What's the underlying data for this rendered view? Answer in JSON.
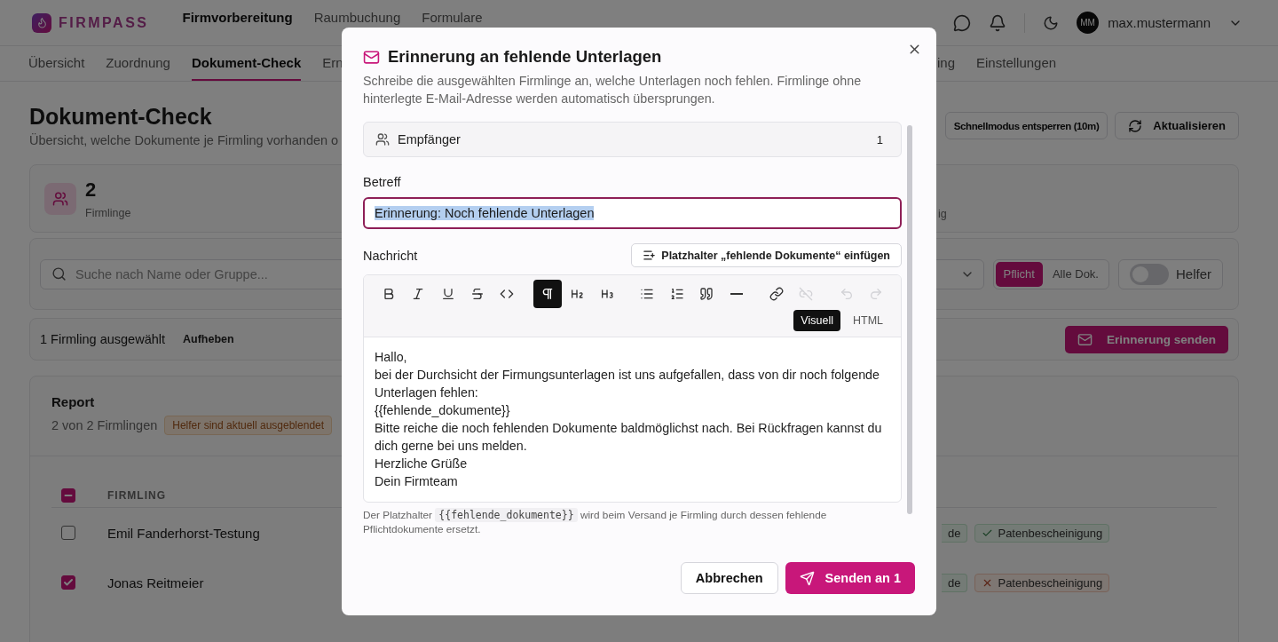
{
  "header": {
    "logo": "FIRMPASS",
    "nav": [
      {
        "label": "Firmvorbereitung",
        "selected": true
      },
      {
        "label": "Raumbuchung",
        "selected": false
      },
      {
        "label": "Formulare",
        "selected": false
      }
    ],
    "user": {
      "initials": "MM",
      "name": "max.mustermann"
    }
  },
  "subnav": {
    "tabs_left": [
      {
        "label": "Übersicht",
        "selected": false
      },
      {
        "label": "Zuordnung",
        "selected": false
      },
      {
        "label": "Dokument-Check",
        "selected": true
      },
      {
        "label": "Ern",
        "selected": false
      }
    ],
    "tabs_right": [
      {
        "label": "ing",
        "selected": false
      },
      {
        "label": "Einstellungen",
        "selected": false
      }
    ]
  },
  "page": {
    "title": "Dokument-Check",
    "subtitle": "Übersicht, welche Dokumente je Firmling vorhanden o",
    "unlock_button": "Schnellmodus entsperren (10m)",
    "refresh_button": "Aktualisieren"
  },
  "stats": {
    "value": "2",
    "label": "Firmlinge",
    "label_2": "ig"
  },
  "filters": {
    "search_placeholder": "Suche nach Name oder Gruppe...",
    "segments": [
      {
        "label": "Pflicht",
        "selected": true
      },
      {
        "label": "Alle Dok.",
        "selected": false
      }
    ],
    "helper_toggle": {
      "label": "Helfer",
      "on": false
    }
  },
  "selection": {
    "text": "1 Firmling ausgewählt",
    "clear": "Aufheben",
    "send": "Erinnerung senden"
  },
  "report": {
    "title": "Report",
    "subtitle": "2 von 2 Firmlingen",
    "badge": "Helfer sind aktuell ausgeblendet",
    "column": "FIRMLING",
    "header_checkbox": {
      "indeterminate": true
    },
    "rows": [
      {
        "name": "Emil Fanderhorst-Testung",
        "checked": false,
        "tags": [
          {
            "label": "de",
            "missing": false,
            "cut": true
          },
          {
            "label": "Patenbescheinigung",
            "missing": false,
            "cut": false
          }
        ]
      },
      {
        "name": "Jonas Reitmeier",
        "checked": true,
        "tags": [
          {
            "label": "de",
            "missing": false,
            "cut": true
          },
          {
            "label": "Patenbescheinigung",
            "missing": true,
            "cut": false
          }
        ]
      }
    ]
  },
  "dialog": {
    "title": "Erinnerung an fehlende Unterlagen",
    "description": "Schreibe die ausgewählten Firmlinge an, welche Unterlagen noch fehlen. Firmlinge ohne hinterlegte E-Mail-Adresse werden automatisch übersprungen.",
    "recipients": {
      "label": "Empfänger",
      "count": "1"
    },
    "subject": {
      "label": "Betreff",
      "value": "Erinnerung: Noch fehlende Unterlagen",
      "text_selected": true
    },
    "message": {
      "label": "Nachricht",
      "insert_button": "Platzhalter „fehlende Dokumente“ einfügen",
      "toolbar": [
        {
          "kind": "bold",
          "active": false,
          "disabled": false
        },
        {
          "kind": "italic",
          "active": false,
          "disabled": false
        },
        {
          "kind": "underline",
          "active": false,
          "disabled": false
        },
        {
          "kind": "strike",
          "active": false,
          "disabled": false
        },
        {
          "kind": "code",
          "active": false,
          "disabled": false
        },
        {
          "kind": "paragraph",
          "active": true,
          "disabled": false
        },
        {
          "kind": "h2",
          "active": false,
          "disabled": false
        },
        {
          "kind": "h3",
          "active": false,
          "disabled": false
        },
        {
          "kind": "bullets",
          "active": false,
          "disabled": false
        },
        {
          "kind": "numbers",
          "active": false,
          "disabled": false
        },
        {
          "kind": "quote",
          "active": false,
          "disabled": false
        },
        {
          "kind": "rule",
          "active": false,
          "disabled": false
        },
        {
          "kind": "link",
          "active": false,
          "disabled": false
        },
        {
          "kind": "unlink",
          "active": false,
          "disabled": true
        },
        {
          "kind": "undo",
          "active": false,
          "disabled": true
        },
        {
          "kind": "redo",
          "active": false,
          "disabled": true
        }
      ],
      "modes": [
        {
          "label": "Visuell",
          "selected": true
        },
        {
          "label": "HTML",
          "selected": false
        }
      ],
      "lines": [
        "Hallo,",
        "bei der Durchsicht der Firmungsunterlagen ist uns aufgefallen, dass von dir noch folgende Unterlagen fehlen:",
        "{{fehlende_dokumente}}",
        "Bitte reiche die noch fehlenden Dokumente baldmöglichst nach. Bei Rückfragen kannst du dich gerne bei uns melden.",
        "Herzliche Grüße",
        "Dein Firmteam"
      ]
    },
    "hint": {
      "before": "Der Platzhalter",
      "code": "{{fehlende_dokumente}}",
      "after": "wird beim Versand je Firmling durch dessen fehlende Pflichtdokumente ersetzt."
    },
    "cancel_button": "Abbrechen",
    "send_button": "Senden an 1"
  }
}
